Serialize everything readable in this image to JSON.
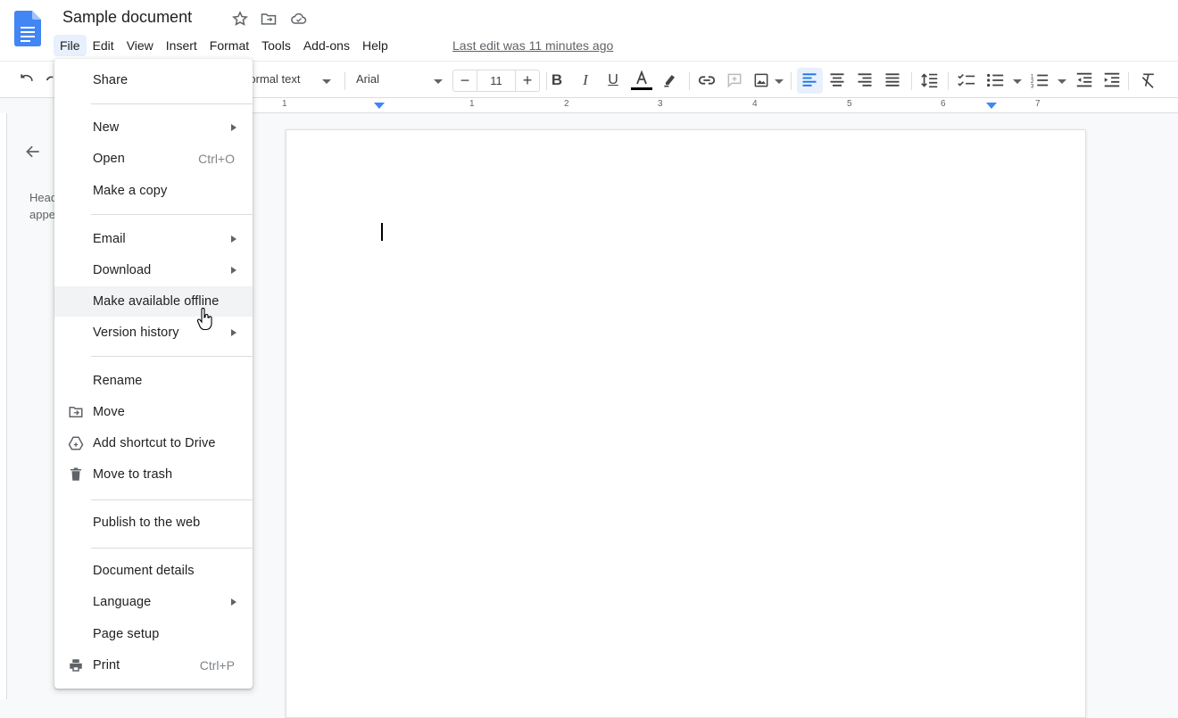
{
  "app": {
    "doc_title": "Sample document",
    "last_edit": "Last edit was 11 minutes ago"
  },
  "menubar": [
    "File",
    "Edit",
    "View",
    "Insert",
    "Format",
    "Tools",
    "Add-ons",
    "Help"
  ],
  "toolbar": {
    "style": "Normal text",
    "font": "Arial",
    "font_size": "11",
    "minus": "−",
    "plus": "+"
  },
  "ruler": [
    "1",
    "1",
    "2",
    "3",
    "4",
    "5",
    "6",
    "7"
  ],
  "outline": {
    "text_line1": "Headings you add to the document will",
    "text_line2": "appear here."
  },
  "file_menu": {
    "share": "Share",
    "new": "New",
    "open": "Open",
    "open_shortcut": "Ctrl+O",
    "make_copy": "Make a copy",
    "email": "Email",
    "download": "Download",
    "offline": "Make available offline",
    "version_history": "Version history",
    "rename": "Rename",
    "move": "Move",
    "add_shortcut": "Add shortcut to Drive",
    "trash": "Move to trash",
    "publish": "Publish to the web",
    "details": "Document details",
    "language": "Language",
    "page_setup": "Page setup",
    "print": "Print",
    "print_shortcut": "Ctrl+P"
  },
  "colors": {
    "accent": "#4285f4",
    "docs_blue": "#4285f4",
    "text_color_bar": "#000000"
  }
}
